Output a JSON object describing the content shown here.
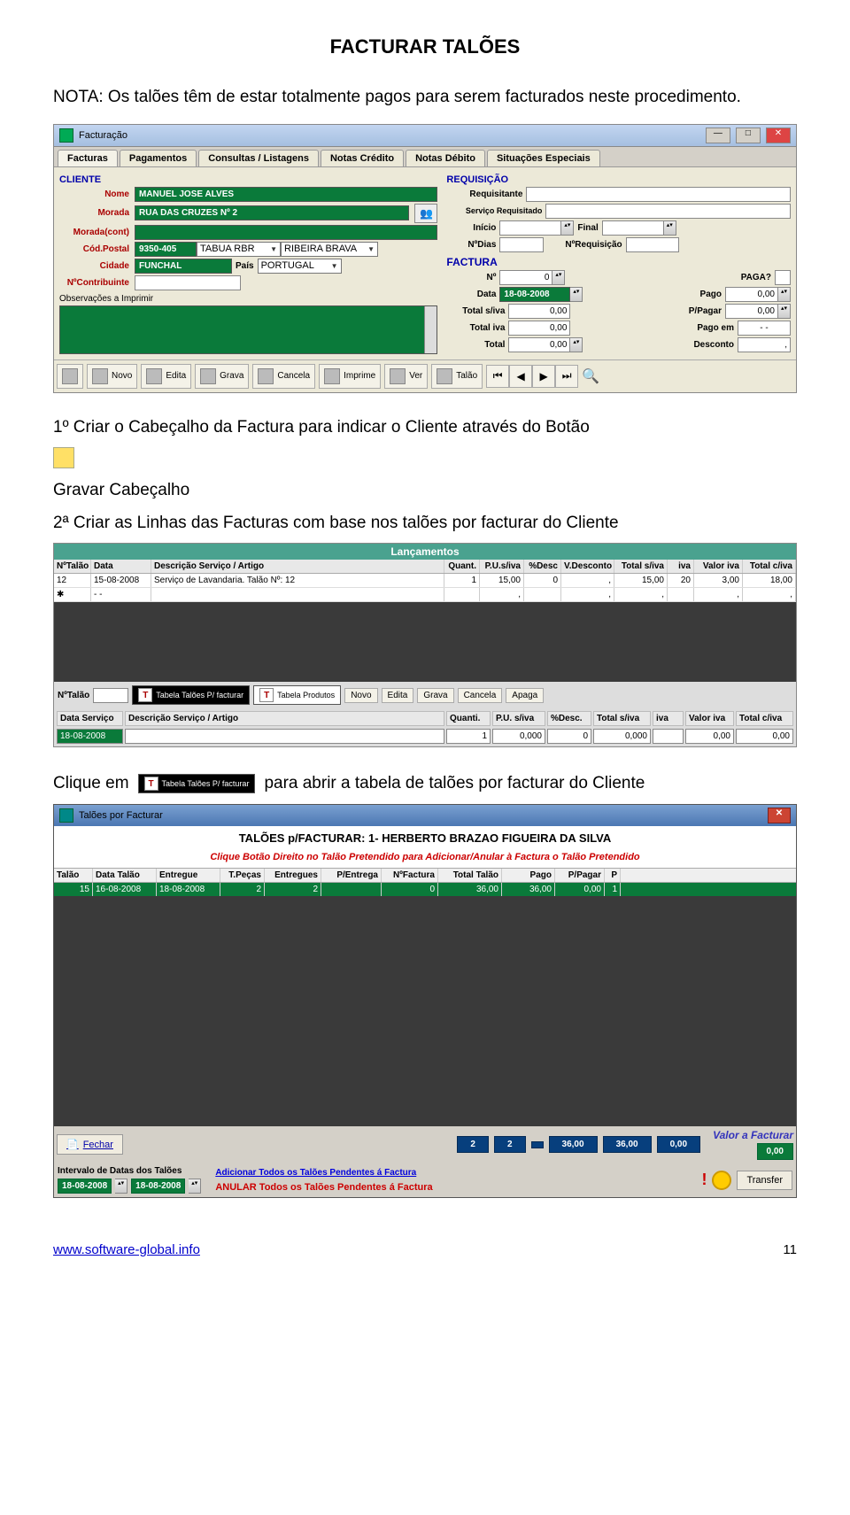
{
  "page": {
    "title": "FACTURAR TALÕES",
    "note": "NOTA: Os talões têm de estar totalmente pagos para serem facturados neste procedimento.",
    "step1": "1º Criar o Cabeçalho da Factura para indicar o Cliente através do Botão",
    "step1b": "Gravar Cabeçalho",
    "step2": "2ª Criar as Linhas das Facturas com base nos talões por facturar do Cliente",
    "clique_prefix": "Clique em",
    "clique_suffix": "para abrir a tabela de talões por facturar do Cliente",
    "footer_url": "www.software-global.info",
    "footer_pg": "11"
  },
  "win1": {
    "title": "Facturação",
    "tabs": [
      "Facturas",
      "Pagamentos",
      "Consultas / Listagens",
      "Notas Crédito",
      "Notas Débito",
      "Situações Especiais"
    ],
    "cliente_head": "CLIENTE",
    "labels": {
      "nome": "Nome",
      "morada": "Morada",
      "moradac": "Morada(cont)",
      "codpost": "Cód.Postal",
      "cidade": "Cidade",
      "pais": "País",
      "ncontrib": "NºContribuinte",
      "obs": "Observações a Imprimir"
    },
    "vals": {
      "nome": "MANUEL JOSE ALVES",
      "morada": "RUA DAS CRUZES Nº 2",
      "moradac": "",
      "codpost": "9350-405",
      "cp_loc": "TABUA RBR",
      "cp_conc": "RIBEIRA BRAVA",
      "cidade": "FUNCHAL",
      "pais": "PORTUGAL",
      "ncontrib": ""
    },
    "req": {
      "head": "REQUISIÇÃO",
      "requisitante": "Requisitante",
      "serv": "Serviço Requisitado",
      "inicio": "Início",
      "final": "Final",
      "ndias": "NºDias",
      "nreq": "NºRequisição"
    },
    "fact": {
      "head": "FACTURA",
      "n": "Nº",
      "n_val": "0",
      "data": "Data",
      "data_val": "18-08-2008",
      "tsiva": "Total s/iva",
      "tsiva_v": "0,00",
      "tiva": "Total iva",
      "tiva_v": "0,00",
      "total": "Total",
      "total_v": "0,00",
      "paga": "PAGA?",
      "pago": "Pago",
      "pago_v": "0,00",
      "ppagar": "P/Pagar",
      "ppagar_v": "0,00",
      "pagoem": "Pago em",
      "pagoem_v": "- -",
      "desconto": "Desconto",
      "desconto_v": ","
    },
    "tb": [
      "",
      "Novo",
      "Edita",
      "Grava",
      "Cancela",
      "Imprime",
      "Ver",
      "Talão"
    ]
  },
  "win2": {
    "header": "Lançamentos",
    "cols": [
      "NºTalão",
      "Data",
      "Descrição Serviço / Artigo",
      "Quant.",
      "P.U.s/iva",
      "%Desc",
      "V.Desconto",
      "Total s/iva",
      "iva",
      "Valor iva",
      "Total c/iva"
    ],
    "row": [
      "12",
      "15-08-2008",
      "Serviço de Lavandaria. Talão Nº: 12",
      "1",
      "15,00",
      "0",
      ",",
      "15,00",
      "20",
      "3,00",
      "18,00"
    ],
    "bt": {
      "nt": "NºTalão",
      "tab1": "Tabela Talões P/ facturar",
      "tab2": "Tabela Produtos",
      "novo": "Novo",
      "edita": "Edita",
      "grava": "Grava",
      "cancela": "Cancela",
      "apaga": "Apaga"
    },
    "sum_labels": [
      "Data Serviço",
      "Descrição Serviço / Artigo",
      "Quanti.",
      "P.U. s/iva",
      "%Desc.",
      "Total s/iva",
      "iva",
      "Valor iva",
      "Total c/iva"
    ],
    "sum_vals": [
      "18-08-2008",
      "",
      "1",
      "0,000",
      "0",
      "0,000",
      "",
      "0,00",
      "0,00"
    ]
  },
  "win3": {
    "title": "Talões por Facturar",
    "head": "TALÕES p/FACTURAR: 1- HERBERTO BRAZAO FIGUEIRA DA SILVA",
    "instr": "Clique Botão Direito no Talão Pretendido  para Adicionar/Anular  à Factura o Talão Pretendido",
    "cols": [
      "Talão",
      "Data Talão",
      "Entregue",
      "T.Peças",
      "Entregues",
      "P/Entrega",
      "NºFactura",
      "Total Talão",
      "Pago",
      "P/Pagar",
      "P"
    ],
    "row": [
      "15",
      "16-08-2008",
      "18-08-2008",
      "2",
      "2",
      "",
      "0",
      "36,00",
      "36,00",
      "0,00",
      "1"
    ],
    "fechar": "Fechar",
    "totals": [
      "2",
      "2",
      "",
      "36,00",
      "36,00",
      "0,00"
    ],
    "val_fact": "Valor a Facturar",
    "val_fact_v": "0,00",
    "intv": "Intervalo de Datas dos Talões",
    "d1": "18-08-2008",
    "d2": "18-08-2008",
    "addall": "Adicionar Todos os Talões Pendentes á Factura",
    "anulall": "ANULAR Todos os Talões Pendentes á Factura",
    "transfer": "Transfer"
  }
}
